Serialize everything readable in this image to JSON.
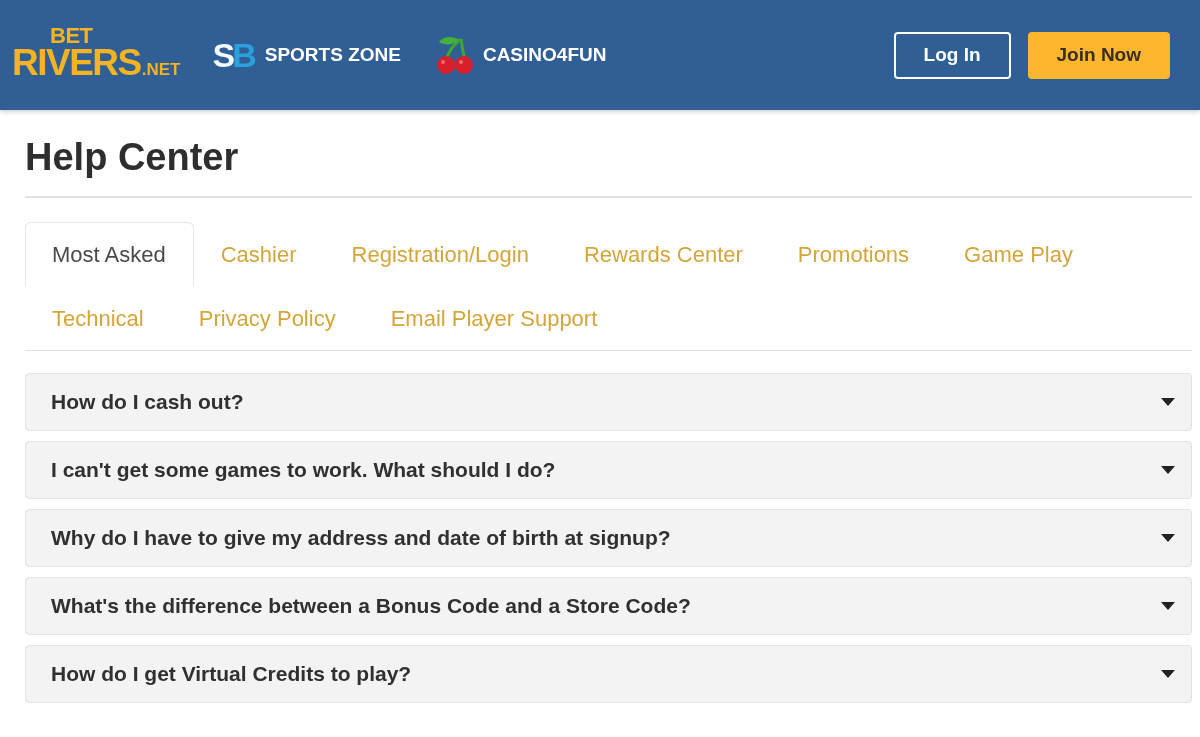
{
  "header": {
    "logo": {
      "top": "BET",
      "main": "RIVERS",
      "suffix": ".NET"
    },
    "nav": [
      {
        "kind": "sports",
        "badge": "SB",
        "label": "SPORTS ZONE"
      },
      {
        "kind": "casino",
        "label": "CASINO4FUN"
      }
    ],
    "buttons": [
      {
        "kind": "outline",
        "label": "Log In"
      },
      {
        "kind": "primary",
        "label": "Join Now"
      }
    ]
  },
  "page_title": "Help Center",
  "tabs": [
    {
      "label": "Most Asked",
      "selected": true
    },
    {
      "label": "Cashier",
      "selected": false
    },
    {
      "label": "Registration/Login",
      "selected": false
    },
    {
      "label": "Rewards Center",
      "selected": false
    },
    {
      "label": "Promotions",
      "selected": false
    },
    {
      "label": "Game Play",
      "selected": false
    },
    {
      "label": "Technical",
      "selected": false
    },
    {
      "label": "Privacy Policy",
      "selected": false
    },
    {
      "label": "Email Player Support",
      "selected": false
    }
  ],
  "faq": [
    {
      "question": "How do I cash out?",
      "expanded": false
    },
    {
      "question": "I can't get some games to work. What should I do?",
      "expanded": false
    },
    {
      "question": "Why do I have to give my address and date of birth at signup?",
      "expanded": false
    },
    {
      "question": "What's the difference between a Bonus Code and a Store Code?",
      "expanded": false
    },
    {
      "question": "How do I get Virtual Credits to play?",
      "expanded": false
    }
  ]
}
